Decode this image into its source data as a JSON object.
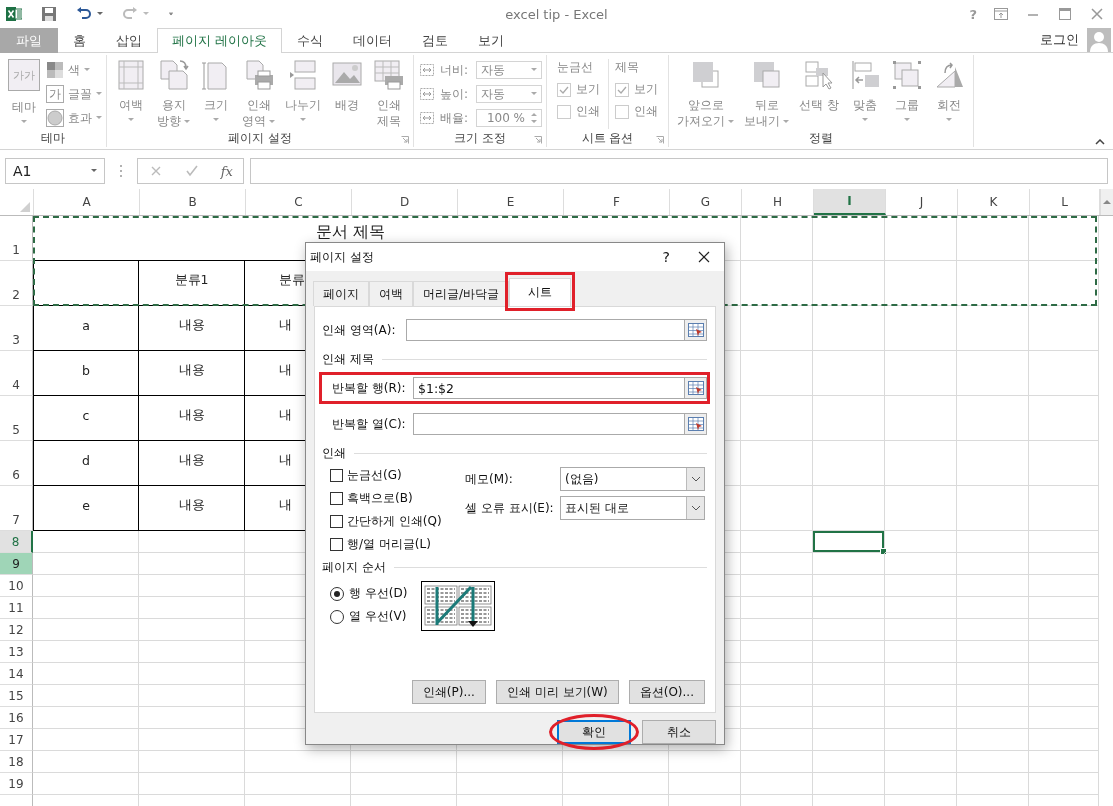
{
  "window": {
    "title": "excel tip - Excel",
    "help_label": "?",
    "account": "로그인"
  },
  "ribbon_tabs": [
    {
      "label": "파일",
      "kind": "file",
      "selected": false
    },
    {
      "label": "홈",
      "kind": "tab",
      "selected": false
    },
    {
      "label": "삽입",
      "kind": "tab",
      "selected": false
    },
    {
      "label": "페이지 레이아웃",
      "kind": "tab",
      "selected": true
    },
    {
      "label": "수식",
      "kind": "tab",
      "selected": false
    },
    {
      "label": "데이터",
      "kind": "tab",
      "selected": false
    },
    {
      "label": "검토",
      "kind": "tab",
      "selected": false
    },
    {
      "label": "보기",
      "kind": "tab",
      "selected": false
    }
  ],
  "ribbon_groups": [
    {
      "label": "테마",
      "launcher": false,
      "items": [
        {
          "kind": "large",
          "lines": [
            "테마"
          ],
          "dropdown": true,
          "icon_text": "가가"
        },
        {
          "kind": "stack",
          "entries": [
            {
              "label": "색",
              "dropdown": true
            },
            {
              "label": "글꼴",
              "dropdown": true,
              "icon_text": "가"
            },
            {
              "label": "효과",
              "dropdown": true
            }
          ]
        }
      ]
    },
    {
      "label": "페이지 설정",
      "launcher": true,
      "items": [
        {
          "kind": "large",
          "lines": [
            "여백"
          ],
          "dropdown": true
        },
        {
          "kind": "large",
          "lines": [
            "용지",
            "방향"
          ],
          "dropdown": true
        },
        {
          "kind": "large",
          "lines": [
            "크기"
          ],
          "dropdown": true
        },
        {
          "kind": "large",
          "lines": [
            "인쇄",
            "영역"
          ],
          "dropdown": true
        },
        {
          "kind": "large",
          "lines": [
            "나누기"
          ],
          "dropdown": true
        },
        {
          "kind": "large",
          "lines": [
            "배경"
          ],
          "dropdown": false
        },
        {
          "kind": "large",
          "lines": [
            "인쇄",
            "제목"
          ],
          "dropdown": false
        }
      ]
    },
    {
      "label": "크기 조정",
      "launcher": true,
      "items": [
        {
          "kind": "fields",
          "entries": [
            {
              "label": "너비:",
              "value": "자동"
            },
            {
              "label": "높이:",
              "value": "자동"
            },
            {
              "label": "배율:",
              "value": "100 %"
            }
          ]
        }
      ]
    },
    {
      "label": "시트 옵션",
      "launcher": true,
      "items": [
        {
          "kind": "checks",
          "heading": "눈금선",
          "entries": [
            {
              "label": "보기",
              "checked": true
            },
            {
              "label": "인쇄",
              "checked": false
            }
          ]
        },
        {
          "kind": "checks",
          "heading": "제목",
          "entries": [
            {
              "label": "보기",
              "checked": true
            },
            {
              "label": "인쇄",
              "checked": false
            }
          ]
        }
      ]
    },
    {
      "label": "정렬",
      "launcher": false,
      "items": [
        {
          "kind": "large",
          "lines": [
            "앞으로",
            "가져오기"
          ],
          "dropdown": true
        },
        {
          "kind": "large",
          "lines": [
            "뒤로",
            "보내기"
          ],
          "dropdown": true
        },
        {
          "kind": "large",
          "lines": [
            "선택 창"
          ],
          "dropdown": false
        },
        {
          "kind": "large",
          "lines": [
            "맞춤"
          ],
          "dropdown": true
        },
        {
          "kind": "large",
          "lines": [
            "그룹"
          ],
          "dropdown": true
        },
        {
          "kind": "large",
          "lines": [
            "회전"
          ],
          "dropdown": true
        }
      ]
    }
  ],
  "formula_bar": {
    "name_box": "A1",
    "function_label": "fx"
  },
  "sheet": {
    "columns": [
      {
        "label": "A",
        "selected": false
      },
      {
        "label": "B",
        "selected": false
      },
      {
        "label": "C",
        "selected": false
      },
      {
        "label": "D",
        "selected": false
      },
      {
        "label": "E",
        "selected": false
      },
      {
        "label": "F",
        "selected": false
      },
      {
        "label": "G",
        "selected": false
      },
      {
        "label": "H",
        "selected": false
      },
      {
        "label": "I",
        "selected": true
      },
      {
        "label": "J",
        "selected": false
      },
      {
        "label": "K",
        "selected": false
      },
      {
        "label": "L",
        "selected": false
      }
    ],
    "rows": [
      {
        "label": "1",
        "kind": "tall",
        "selected": false,
        "highlighted": false,
        "title": "문서 제목"
      },
      {
        "label": "2",
        "kind": "tall",
        "selected": false,
        "highlighted": false,
        "header": [
          "분류1",
          "분류"
        ]
      },
      {
        "label": "3",
        "kind": "tall",
        "selected": false,
        "highlighted": false,
        "cells": [
          "a",
          "내용",
          "내"
        ]
      },
      {
        "label": "4",
        "kind": "tall",
        "selected": false,
        "highlighted": false,
        "cells": [
          "b",
          "내용",
          "내"
        ]
      },
      {
        "label": "5",
        "kind": "tall",
        "selected": false,
        "highlighted": false,
        "cells": [
          "c",
          "내용",
          "내"
        ]
      },
      {
        "label": "6",
        "kind": "tall",
        "selected": false,
        "highlighted": false,
        "cells": [
          "d",
          "내용",
          "내"
        ]
      },
      {
        "label": "7",
        "kind": "tall",
        "selected": false,
        "highlighted": false,
        "cells": [
          "e",
          "내용",
          "내"
        ]
      },
      {
        "label": "8",
        "kind": "normal",
        "selected": true,
        "highlighted": false
      },
      {
        "label": "9",
        "kind": "normal",
        "selected": false,
        "highlighted": true
      },
      {
        "label": "10",
        "kind": "normal",
        "selected": false,
        "highlighted": false
      },
      {
        "label": "11",
        "kind": "normal",
        "selected": false,
        "highlighted": false
      },
      {
        "label": "12",
        "kind": "normal",
        "selected": false,
        "highlighted": false
      },
      {
        "label": "13",
        "kind": "normal",
        "selected": false,
        "highlighted": false
      },
      {
        "label": "14",
        "kind": "normal",
        "selected": false,
        "highlighted": false
      },
      {
        "label": "15",
        "kind": "normal",
        "selected": false,
        "highlighted": false
      },
      {
        "label": "16",
        "kind": "normal",
        "selected": false,
        "highlighted": false
      },
      {
        "label": "17",
        "kind": "normal",
        "selected": false,
        "highlighted": false
      },
      {
        "label": "18",
        "kind": "normal",
        "selected": false,
        "highlighted": false
      },
      {
        "label": "19",
        "kind": "normal",
        "selected": false,
        "highlighted": false
      }
    ]
  },
  "dialog": {
    "title": "페이지 설정",
    "help_label": "?",
    "tabs": [
      {
        "label": "페이지",
        "selected": false,
        "highlighted": false
      },
      {
        "label": "여백",
        "selected": false,
        "highlighted": false
      },
      {
        "label": "머리글/바닥글",
        "selected": false,
        "highlighted": false
      },
      {
        "label": "시트",
        "selected": true,
        "highlighted": true
      }
    ],
    "print_area": {
      "label": "인쇄 영역(A):",
      "highlighted": false
    },
    "print_titles": {
      "heading": "인쇄 제목",
      "fields": [
        {
          "label": "반복할 행(R):",
          "value": "$1:$2",
          "highlighted": true
        },
        {
          "label": "반복할 열(C):",
          "highlighted": false
        }
      ]
    },
    "print_options": {
      "heading": "인쇄",
      "checkboxes": [
        {
          "label": "눈금선(G)",
          "checked": false
        },
        {
          "label": "흑백으로(B)",
          "checked": false
        },
        {
          "label": "간단하게 인쇄(Q)",
          "checked": false
        },
        {
          "label": "행/열 머리글(L)",
          "checked": false
        }
      ],
      "dropdowns": [
        {
          "label": "메모(M):",
          "value": "(없음)"
        },
        {
          "label": "셀 오류 표시(E):",
          "value": "표시된 대로"
        }
      ]
    },
    "page_order": {
      "heading": "페이지 순서",
      "options": [
        {
          "label": "행 우선(D)",
          "selected": true
        },
        {
          "label": "열 우선(V)",
          "selected": false
        }
      ]
    },
    "panel_buttons": [
      "인쇄(P)...",
      "인쇄 미리 보기(W)",
      "옵션(O)..."
    ],
    "footer_buttons": [
      {
        "label": "확인",
        "kind": "default",
        "highlighted": true
      },
      {
        "label": "취소",
        "kind": "normal",
        "highlighted": false
      }
    ]
  }
}
